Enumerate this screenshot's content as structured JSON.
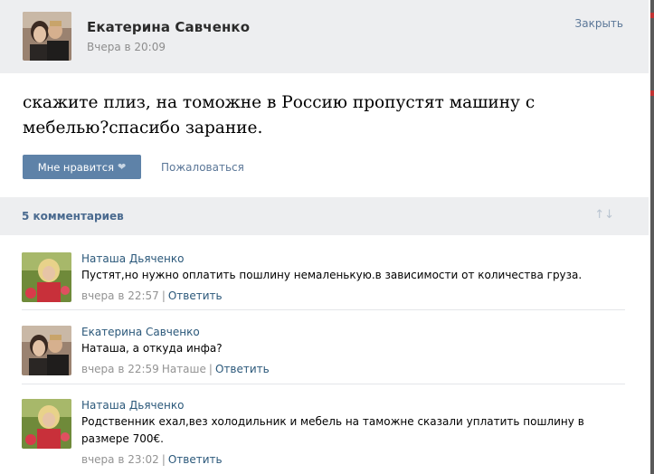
{
  "post": {
    "author": "Екатерина Савченко",
    "time": "Вчера в 20:09",
    "close_label": "Закрыть",
    "text": "скажите плиз, на томожне в Россию пропустят машину с мебелью?спасибо зарание.",
    "like_label": "Мне нравится",
    "report_label": "Пожаловаться"
  },
  "comments_header": {
    "count_label": "5 комментариев"
  },
  "comments": [
    {
      "author": "Наташа Дьяченко",
      "text": "Пустят,но нужно оплатить пошлину немаленькую.в зависимости от количества груза.",
      "time": "вчера в 22:57",
      "reply_to": "",
      "reply_label": "Ответить"
    },
    {
      "author": "Екатерина Савченко",
      "text": "Наташа, а откуда инфа?",
      "time": "вчера в 22:59",
      "reply_to": "Наташе",
      "reply_label": "Ответить"
    },
    {
      "author": "Наташа Дьяченко",
      "text": "Родственник ехал,вез холодильник и мебель на таможне сказали уплатить пошлину в размере 700€.",
      "time": "вчера в 23:02",
      "reply_to": "",
      "reply_label": "Ответить"
    }
  ],
  "colors": {
    "header_bg": "#edeef0",
    "link": "#2b587a",
    "like_button": "#5e82a8",
    "comments_count": "#4a6a8f"
  },
  "icons": {
    "like": "heart-icon",
    "sort": "sort-arrows-icon"
  }
}
